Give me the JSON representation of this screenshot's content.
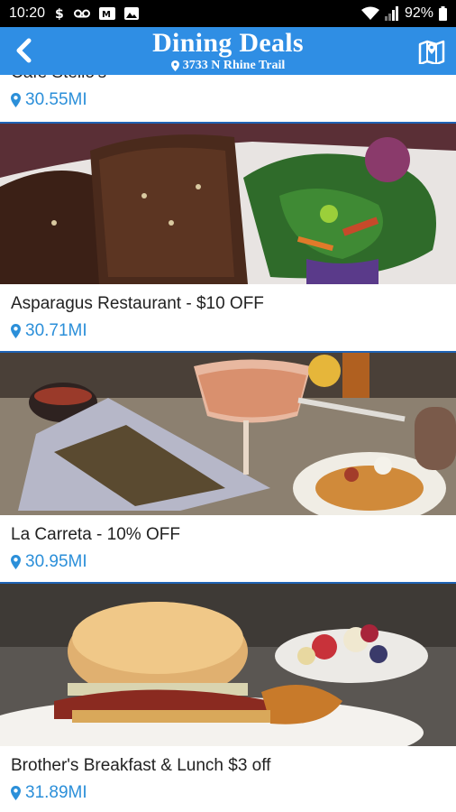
{
  "status_bar": {
    "time": "10:20",
    "battery": "92%",
    "left_icons": [
      "dollar-icon",
      "voicemail-icon",
      "mail-icon",
      "image-icon"
    ],
    "right_icons": [
      "wifi-icon",
      "signal-icon",
      "battery-icon"
    ]
  },
  "header": {
    "title": "Dining Deals",
    "subtitle": "3733 N Rhine Trail",
    "color": "#2f8ee4"
  },
  "restaurants": [
    {
      "name": "Cafe Stello's",
      "distance": "30.55MI"
    },
    {
      "name": "Asparagus Restaurant - $10 OFF",
      "distance": "30.71MI"
    },
    {
      "name": "La Carreta - 10% OFF",
      "distance": "30.95MI"
    },
    {
      "name": "Brother's Breakfast & Lunch $3 off",
      "distance": "31.89MI"
    }
  ],
  "colors": {
    "accent": "#2b8fd9",
    "divider": "#1f63b5"
  }
}
